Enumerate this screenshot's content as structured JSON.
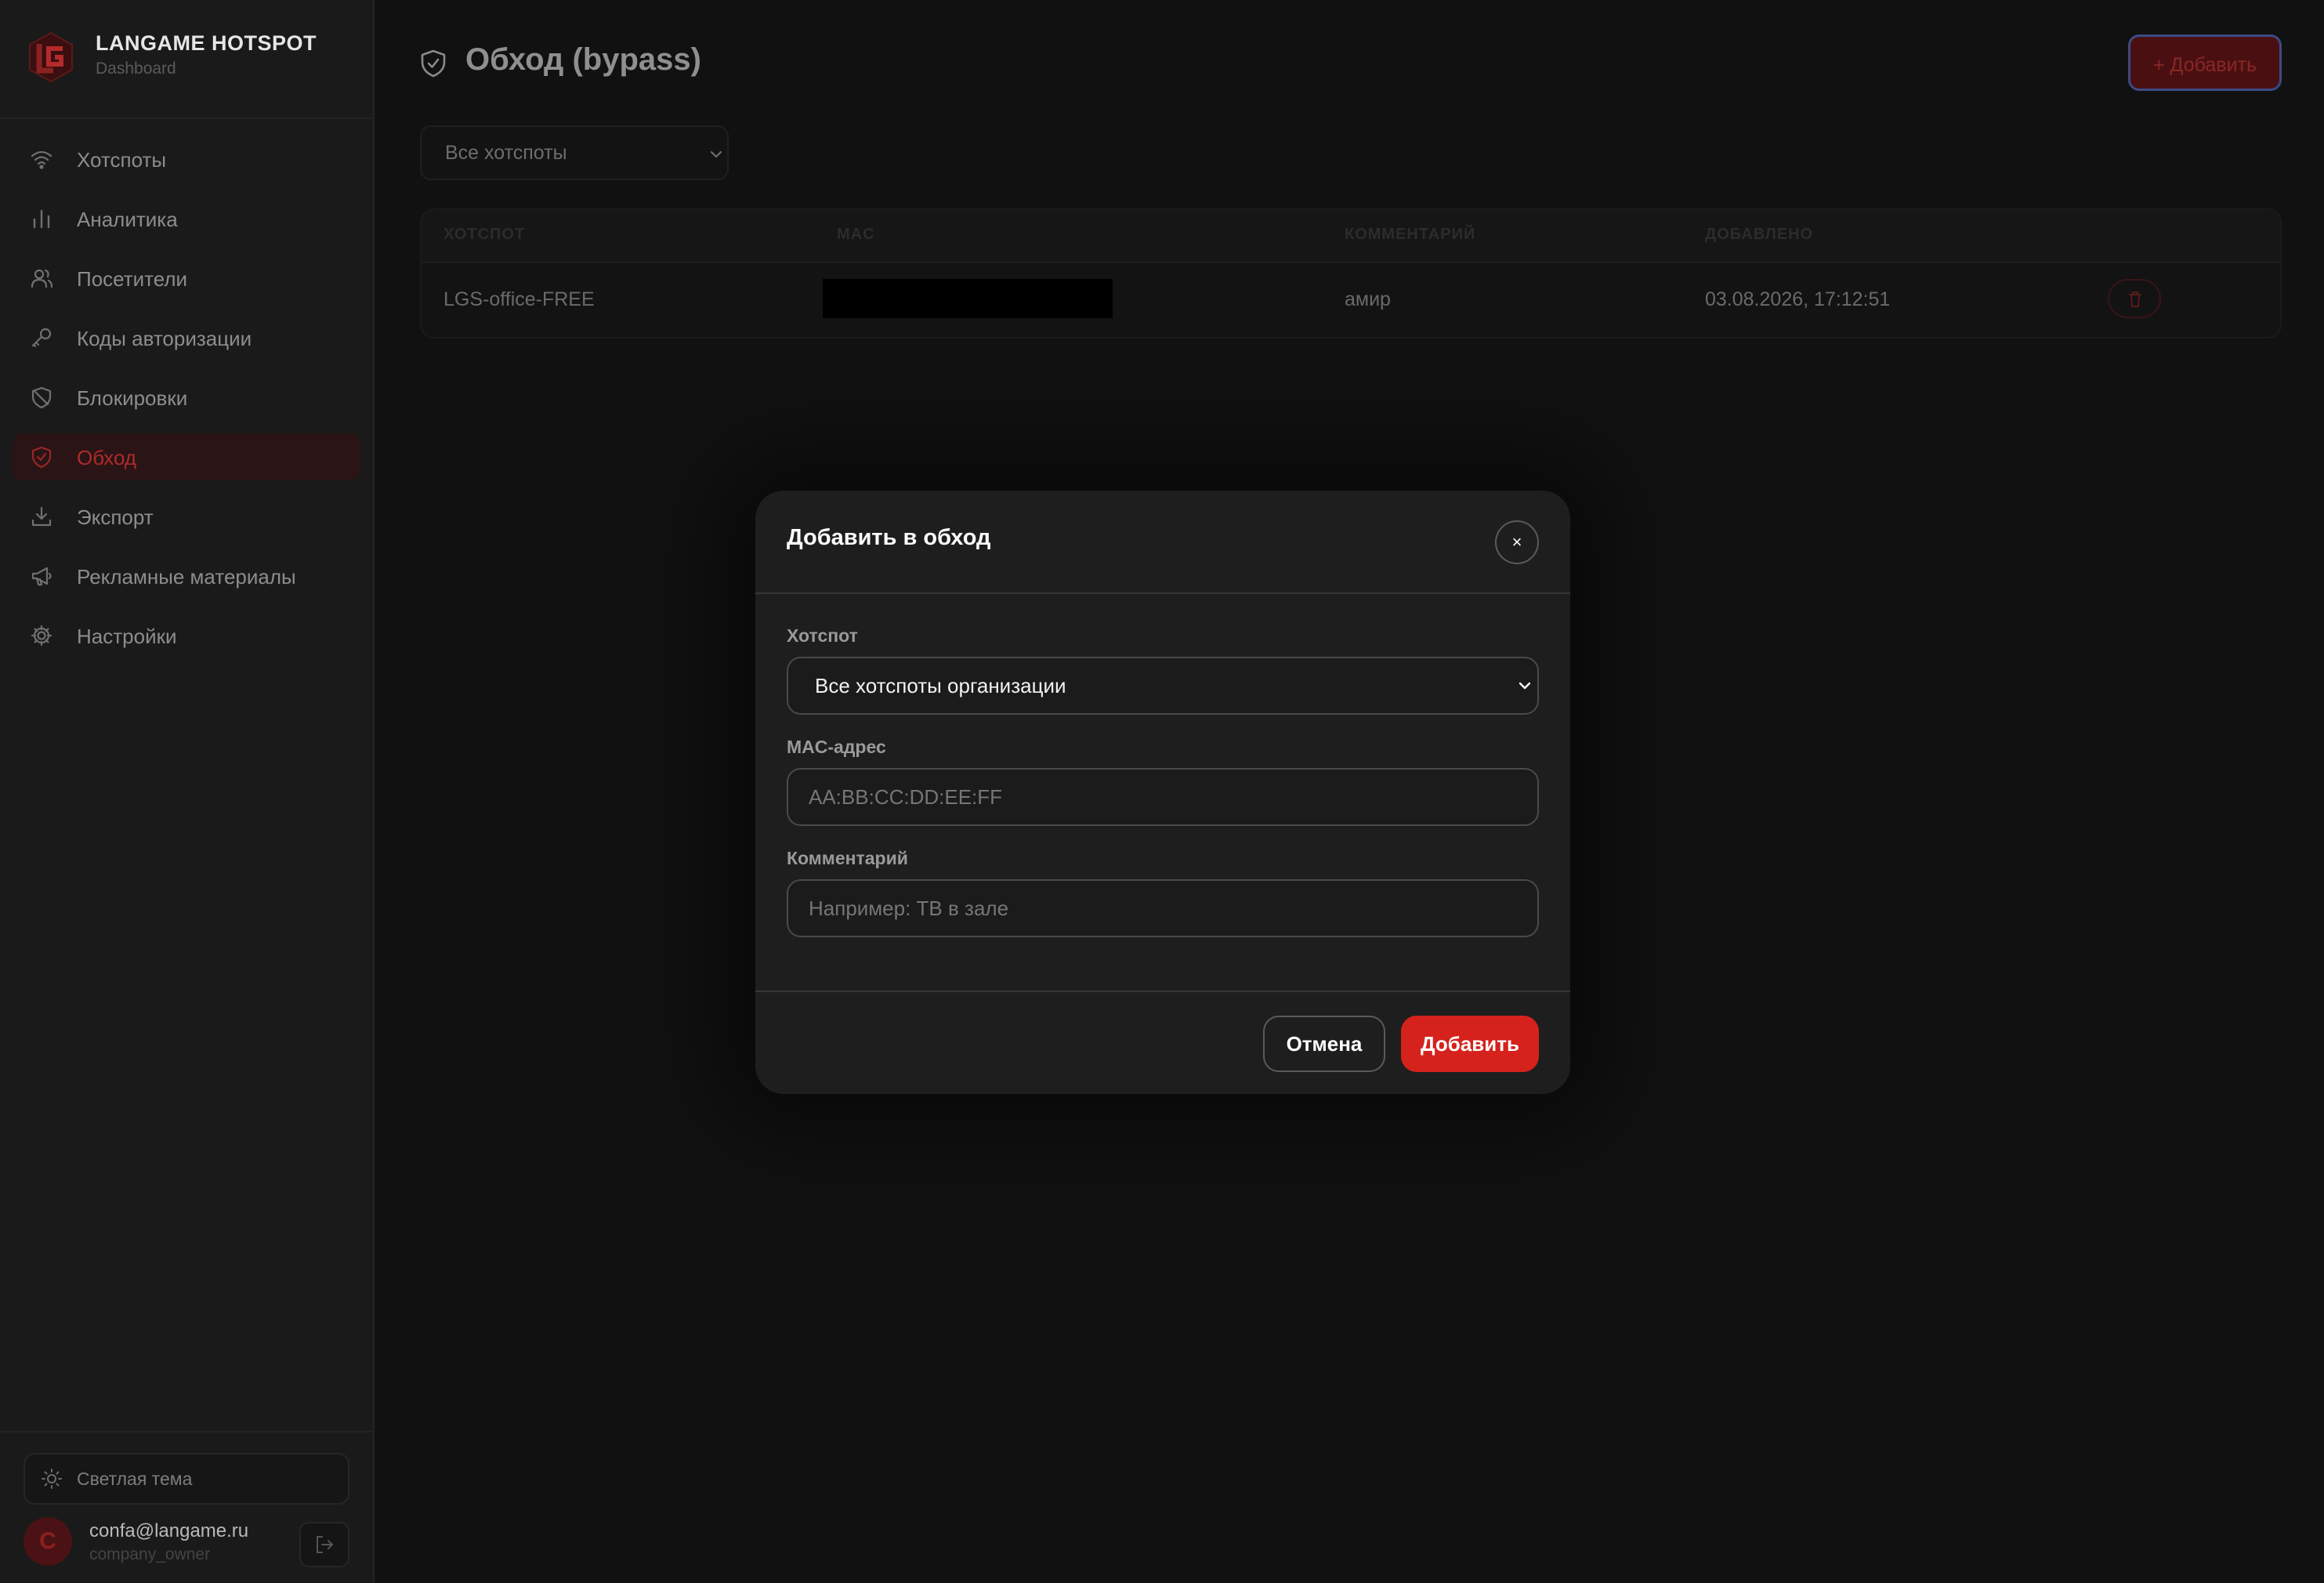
{
  "brand": {
    "name": "LANGAME HOTSPOT",
    "subtitle": "Dashboard"
  },
  "sidebar": {
    "items": [
      {
        "label": "Хотспоты",
        "icon": "wifi-icon",
        "active": false
      },
      {
        "label": "Аналитика",
        "icon": "bar-chart-icon",
        "active": false
      },
      {
        "label": "Посетители",
        "icon": "users-icon",
        "active": false
      },
      {
        "label": "Коды авторизации",
        "icon": "key-icon",
        "active": false
      },
      {
        "label": "Блокировки",
        "icon": "shield-off-icon",
        "active": false
      },
      {
        "label": "Обход",
        "icon": "shield-check-icon",
        "active": true
      },
      {
        "label": "Экспорт",
        "icon": "download-icon",
        "active": false
      },
      {
        "label": "Рекламные материалы",
        "icon": "megaphone-icon",
        "active": false
      },
      {
        "label": "Настройки",
        "icon": "gear-icon",
        "active": false
      }
    ],
    "theme_toggle": "Светлая тема",
    "user": {
      "initial": "C",
      "email": "confa@langame.ru",
      "role": "company_owner"
    }
  },
  "page": {
    "title": "Обход (bypass)",
    "add_button": "+ Добавить",
    "filter_value": "Все хотспоты"
  },
  "table": {
    "headers": [
      "ХОТСПОТ",
      "MAC",
      "КОММЕНТАРИЙ",
      "ДОБАВЛЕНО"
    ],
    "rows": [
      {
        "hotspot": "LGS-office-FREE",
        "mac": "",
        "comment": "амир",
        "added": "03.08.2026, 17:12:51"
      }
    ]
  },
  "modal": {
    "title": "Добавить в обход",
    "close": "×",
    "hotspot_label": "Хотспот",
    "hotspot_value": "Все хотспоты организации",
    "mac_label": "MAC-адрес",
    "mac_placeholder": "AA:BB:CC:DD:EE:FF",
    "comment_label": "Комментарий",
    "comment_placeholder": "Например: ТВ в зале",
    "cancel": "Отмена",
    "submit": "Добавить"
  },
  "colors": {
    "accent": "#d5221d",
    "background": "#111111",
    "sidebar": "#1a1a1a",
    "modal": "#1e1e1e"
  }
}
